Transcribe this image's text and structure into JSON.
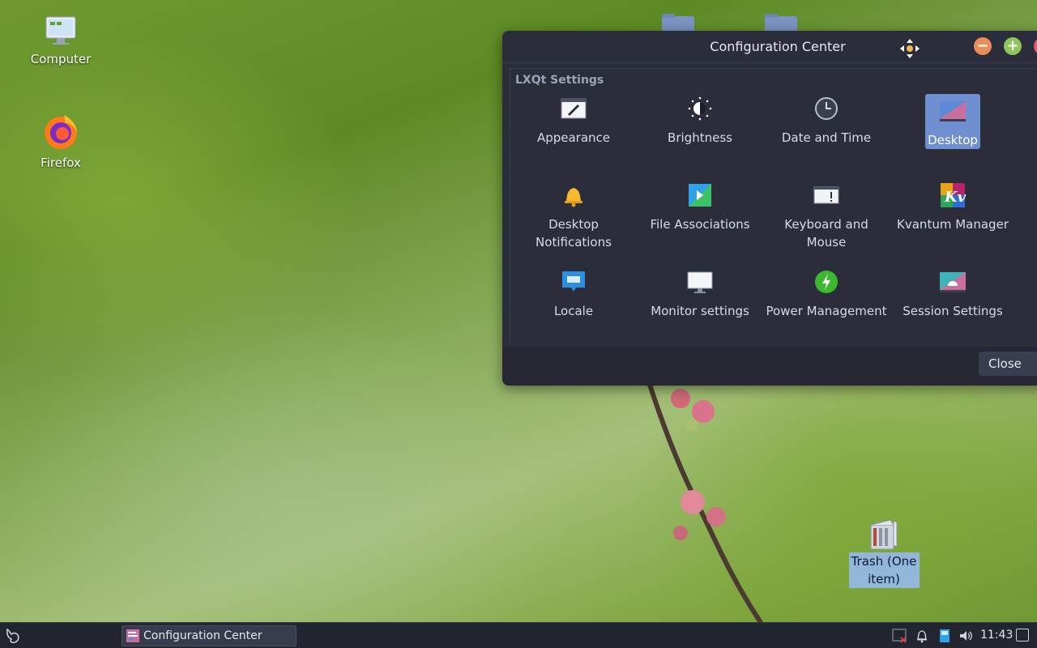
{
  "desktop": {
    "icons": [
      {
        "label": "Computer"
      },
      {
        "label": "Firefox"
      },
      {
        "label": "Trash (One item)"
      }
    ]
  },
  "window": {
    "title": "Configuration Center",
    "section_title": "LXQt Settings",
    "items": [
      {
        "label": "Appearance",
        "icon": "appearance-icon"
      },
      {
        "label": "Brightness",
        "icon": "brightness-icon"
      },
      {
        "label": "Date and Time",
        "icon": "clock-icon"
      },
      {
        "label": "Desktop",
        "icon": "desktop-icon",
        "selected": true
      },
      {
        "label": "Desktop Notifications",
        "icon": "bell-icon"
      },
      {
        "label": "File Associations",
        "icon": "file-associations-icon"
      },
      {
        "label": "Keyboard and Mouse",
        "icon": "keyboard-icon"
      },
      {
        "label": "Kvantum Manager",
        "icon": "kvantum-icon"
      },
      {
        "label": "Locale",
        "icon": "locale-icon"
      },
      {
        "label": "Monitor settings",
        "icon": "monitor-icon"
      },
      {
        "label": "Power Management",
        "icon": "power-icon"
      },
      {
        "label": "Session Settings",
        "icon": "session-icon"
      }
    ],
    "close_label": "Close"
  },
  "taskbar": {
    "task_label": "Configuration Center",
    "clock": "11:43"
  },
  "colors": {
    "window_bg": "#2b2d3b",
    "selection": "#6f8fd1",
    "taskbar_bg": "#23252f"
  }
}
